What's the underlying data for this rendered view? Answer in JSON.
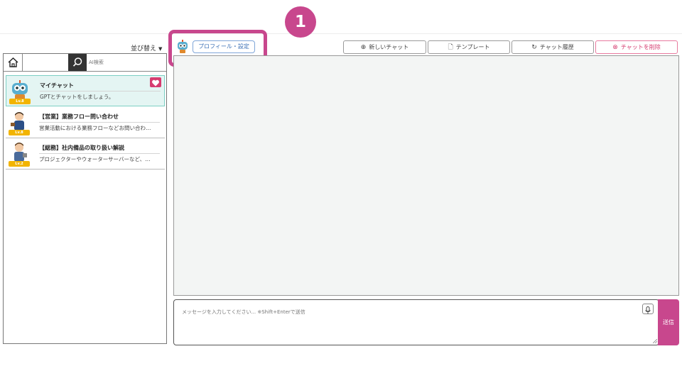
{
  "annotation": {
    "step_number": "1"
  },
  "toolbar": {
    "sort_label": "並び替え",
    "profile_button": "プロフィール・設定",
    "new_chat": "新しいチャット",
    "template": "テンプレート",
    "history": "チャット履歴",
    "delete_chat": "チャットを削除"
  },
  "sidebar": {
    "search_placeholder": "AI検索",
    "items": [
      {
        "title": "マイチャット",
        "desc": "GPTとチャットをしましょう。",
        "level": "Lv.8",
        "favorite": true,
        "selected": true
      },
      {
        "title": "【営業】業務フロー問い合わせ",
        "desc": "営業活動における業務フローなどお問い合わ…",
        "level": "Lv.8",
        "favorite": false,
        "selected": false
      },
      {
        "title": "【総務】社内備品の取り扱い解説",
        "desc": "プロジェクターやウォーターサーバーなど、…",
        "level": "Lv.2",
        "favorite": false,
        "selected": false
      }
    ]
  },
  "composer": {
    "placeholder": "メッセージを入力してください... ※Shift+Enterで送信",
    "send_label": "送信"
  },
  "colors": {
    "accent": "#c8478d",
    "danger": "#d63c70",
    "selected_bg": "#e4f5f3",
    "level_badge": "#f2b400",
    "profile_link": "#3a6fb5"
  }
}
